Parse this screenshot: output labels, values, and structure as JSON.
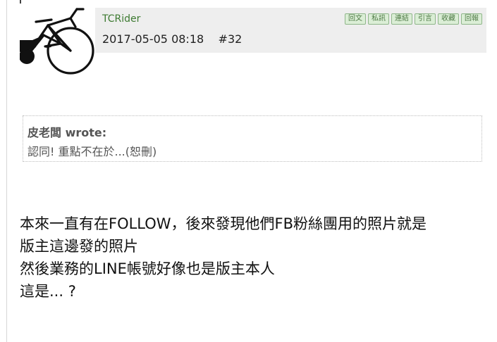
{
  "post": {
    "username": "TCRider",
    "datetime": "2017-05-05 08:18",
    "number": "#32",
    "actions": [
      "回文",
      "私訊",
      "連結",
      "引言",
      "收藏",
      "回報"
    ]
  },
  "quote": {
    "author": "皮老闆 wrote:",
    "text": "認同! 重點不在於...(恕刪)"
  },
  "body": {
    "lines": [
      "本來一直有在FOLLOW，後來發現他們FB粉絲團用的照片就是",
      "版主這邊發的照片",
      "然後業務的LINE帳號好像也是版主本人",
      "這是... ?"
    ]
  },
  "colors": {
    "header_bg": "#eeeeee",
    "username": "#3d7a31",
    "button_bg": "#dbeed6",
    "button_border": "#8fb68a"
  },
  "icons": {
    "avatar": "road-bike-icon"
  }
}
